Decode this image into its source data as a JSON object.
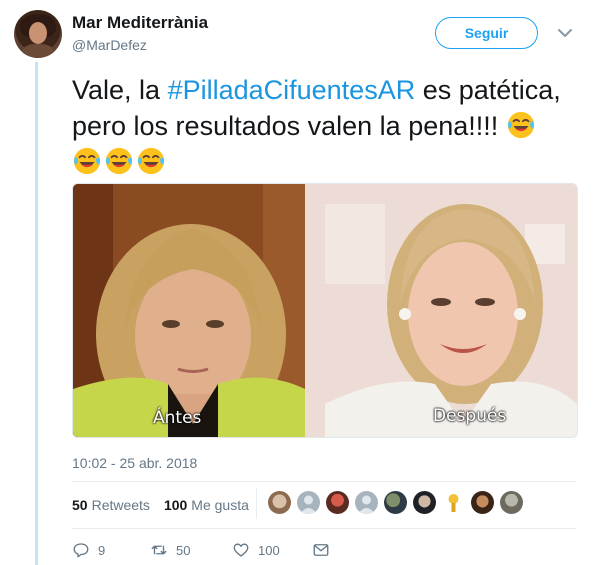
{
  "user": {
    "name": "Mar Mediterrània",
    "handle": "@MarDefez"
  },
  "follow_label": "Seguir",
  "tweet": {
    "text_before": "Vale, la ",
    "hashtag": "#PilladaCifuentesAR",
    "text_after": " es patética, pero los resultados valen la pena!!!! ",
    "emoji": "face-with-tears-of-joy"
  },
  "media": {
    "left_caption": "Ántes",
    "right_caption": "Después"
  },
  "timestamp": "10:02 - 25 abr. 2018",
  "stats": {
    "retweets_count": "50",
    "retweets_label": "Retweets",
    "likes_count": "100",
    "likes_label": "Me gusta"
  },
  "actions": {
    "reply_count": "9",
    "retweet_count": "50",
    "like_count": "100"
  },
  "colors": {
    "accent": "#1da1f2",
    "hashtag": "#1b95e0",
    "secondary_text": "#657786",
    "thread_line": "#c4e4f0"
  }
}
